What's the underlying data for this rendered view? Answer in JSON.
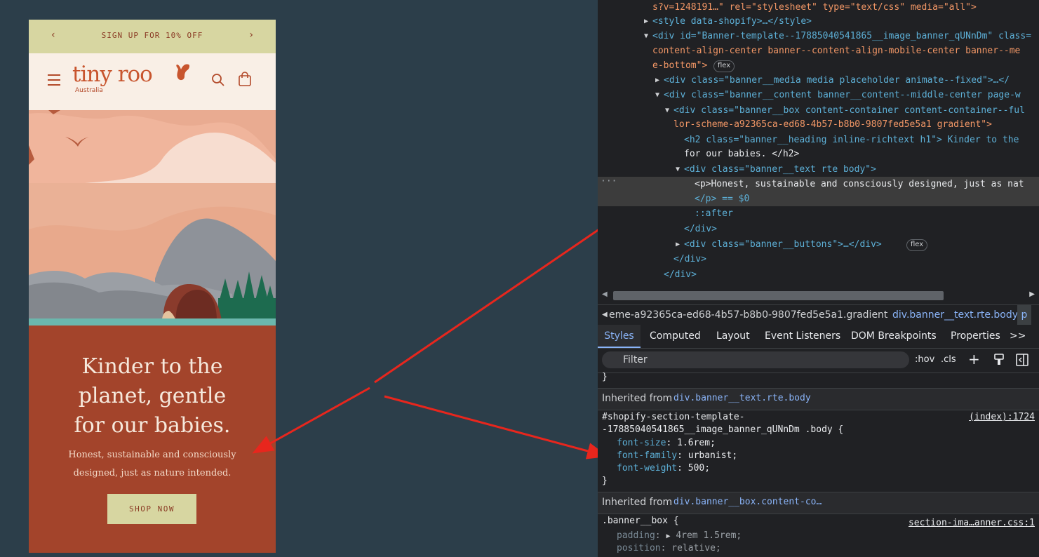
{
  "preview": {
    "announcement": {
      "text": "SIGN UP FOR 10% OFF",
      "prev": "‹",
      "next": "›"
    },
    "header": {
      "logo": "tiny roo",
      "logo_sub": "Australia",
      "menu_icon": "menu-icon",
      "search_icon": "search-icon",
      "cart_icon": "bag-icon"
    },
    "banner": {
      "heading_lines": [
        "Kinder to the",
        "planet, gentle",
        "for our babies."
      ],
      "text_lines": [
        "Honest, sustainable and consciously",
        "designed, just as nature intended."
      ],
      "button": "SHOP NOW"
    },
    "colors": {
      "announce": "#d7d6a1",
      "header": "#f9efe6",
      "banner": "#a3442b",
      "logo": "#c8552e"
    }
  },
  "devtools": {
    "dom": [
      {
        "text": "s?v=1248191…\" rel=\"stylesheet\" type=\"text/css\" media=\"all\">"
      },
      {
        "text": "<style data-shopify>…</style>"
      },
      {
        "text": "<div id=\"Banner-template--17885040541865__image_banner_qUNnDm\" class="
      },
      {
        "text": "content-align-center banner--content-align-mobile-center banner--me"
      },
      {
        "text": "e-bottom\">",
        "badge": "flex"
      },
      {
        "text": "<div class=\"banner__media media placeholder animate--fixed\">…</"
      },
      {
        "text": "<div class=\"banner__content banner__content--middle-center page-w"
      },
      {
        "text": "<div class=\"banner__box content-container content-container--ful"
      },
      {
        "text": "lor-scheme-a92365ca-ed68-4b57-b8b0-9807fed5e5a1 gradient\">"
      },
      {
        "text": "<h2 class=\"banner__heading inline-richtext h1\"> Kinder to the"
      },
      {
        "text": "for our babies. </h2>"
      },
      {
        "text": "<div class=\"banner__text rte body\">"
      },
      {
        "text": "<p>Honest, sustainable and consciously designed, just as nat"
      },
      {
        "text": "</p> == $0"
      },
      {
        "text": "::after"
      },
      {
        "text": "</div>"
      },
      {
        "text": "<div class=\"banner__buttons\">…</div>",
        "badge": "flex"
      },
      {
        "text": "</div>"
      },
      {
        "text": "</div>"
      }
    ],
    "breadcrumbs": [
      "eme-a92365ca-ed68-4b57-b8b0-9807fed5e5a1.gradient",
      "div.banner__text.rte.body",
      "p"
    ],
    "tabs": [
      "Styles",
      "Computed",
      "Layout",
      "Event Listeners",
      "DOM Breakpoints",
      "Properties",
      ">>"
    ],
    "filter": {
      "placeholder": "Filter",
      "hov": ":hov",
      "cls": ".cls"
    },
    "styles": {
      "brace": "}",
      "inherited1": {
        "label": "Inherited from ",
        "link": "div.banner__text.rte.body"
      },
      "rule1": {
        "selector_line1": "#shopify-section-template-",
        "selector_line2": "-17885040541865__image_banner_qUNnDm .body {",
        "source": "(index):1724",
        "props": [
          {
            "name": "font-size",
            "value": "1.6rem;"
          },
          {
            "name": "font-family",
            "value": "urbanist;"
          },
          {
            "name": "font-weight",
            "value": "500;"
          }
        ],
        "close": "}"
      },
      "inherited2": {
        "label": "Inherited from ",
        "link": "div.banner__box.content-co…"
      },
      "rule2": {
        "selector": ".banner__box {",
        "source": "section-ima…anner.css:1",
        "props": [
          {
            "name": "padding",
            "value": "4rem 1.5rem;"
          },
          {
            "name": "position",
            "value": "relative;"
          }
        ]
      }
    }
  }
}
